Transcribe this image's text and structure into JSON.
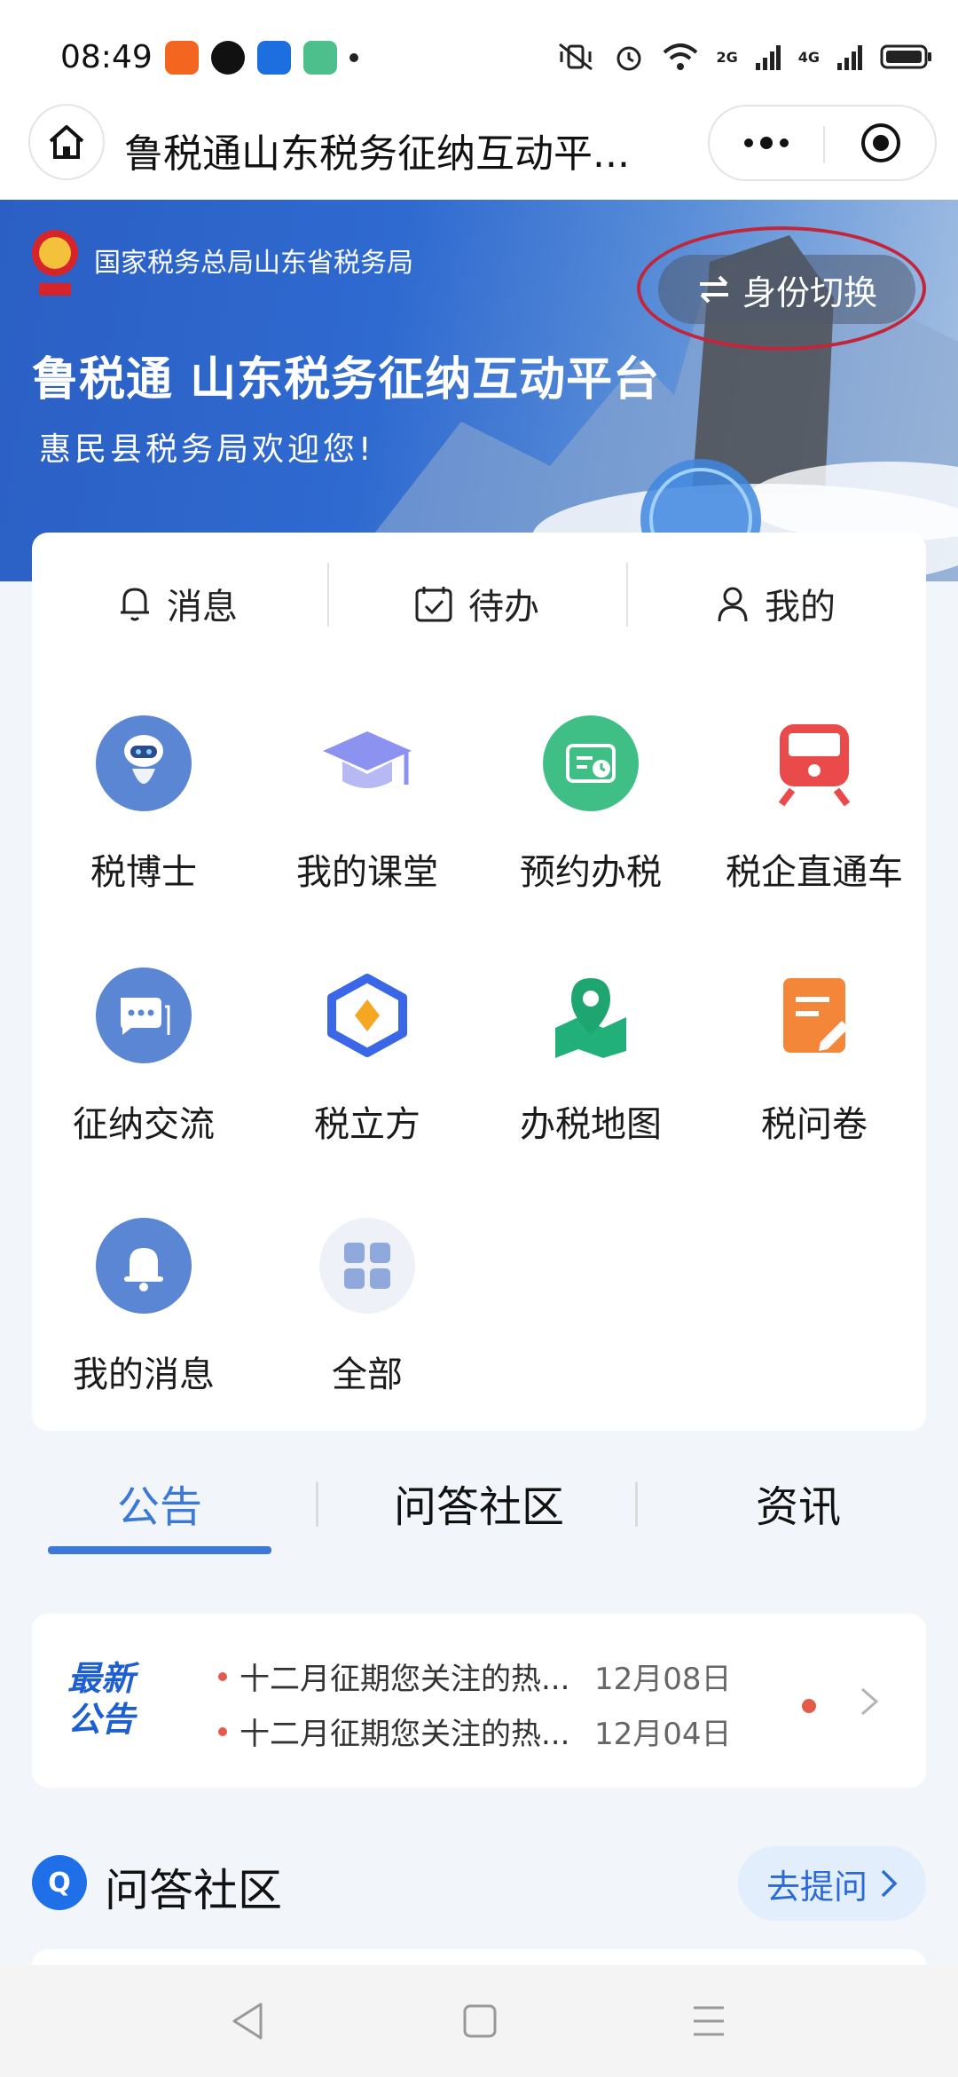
{
  "status_bar": {
    "time": "08:49",
    "network_2g": "2G",
    "network_4g": "4G"
  },
  "title_bar": {
    "title": "鲁税通山东税务征纳互动平..."
  },
  "banner": {
    "org_name": "国家税务总局山东省税务局",
    "title": "鲁税通 山东税务征纳互动平台",
    "welcome": "惠民县税务局欢迎您!",
    "switch_label": "身份切换",
    "colors": {
      "highlight_ring": "#c2263a"
    }
  },
  "quick_actions": [
    {
      "label": "消息",
      "icon": "bell-icon"
    },
    {
      "label": "待办",
      "icon": "calendar-check-icon"
    },
    {
      "label": "我的",
      "icon": "user-icon"
    }
  ],
  "services": [
    {
      "label": "税博士",
      "icon": "robot-icon",
      "color": "#5b86d4"
    },
    {
      "label": "我的课堂",
      "icon": "graduation-cap-icon",
      "color": "#8c92ef"
    },
    {
      "label": "预约办税",
      "icon": "appointment-icon",
      "color": "#3fbf86"
    },
    {
      "label": "税企直通车",
      "icon": "train-icon",
      "color": "#ea4a4a"
    },
    {
      "label": "征纳交流",
      "icon": "chat-icon",
      "color": "#5b86d4"
    },
    {
      "label": "税立方",
      "icon": "cube-icon",
      "color": "#3a67e8"
    },
    {
      "label": "办税地图",
      "icon": "map-pin-icon",
      "color": "#22b07a"
    },
    {
      "label": "税问卷",
      "icon": "survey-icon",
      "color": "#f4863a"
    },
    {
      "label": "我的消息",
      "icon": "bell-icon",
      "color": "#5b86d4"
    },
    {
      "label": "全部",
      "icon": "grid-icon",
      "color": "#8fa9dc"
    }
  ],
  "tabs": [
    {
      "label": "公告",
      "active": true
    },
    {
      "label": "问答社区",
      "active": false
    },
    {
      "label": "资讯",
      "active": false
    }
  ],
  "announcements": {
    "badge_line1": "最新",
    "badge_line2": "公告",
    "items": [
      {
        "title": "十二月征期您关注的热...",
        "date": "12月08日"
      },
      {
        "title": "十二月征期您关注的热...",
        "date": "12月04日"
      }
    ]
  },
  "qa_section": {
    "title": "问答社区",
    "ask_label": "去提问",
    "icon_letter": "Q"
  },
  "colors": {
    "accent": "#3b78d8",
    "page_bg": "#f2f5fa"
  }
}
